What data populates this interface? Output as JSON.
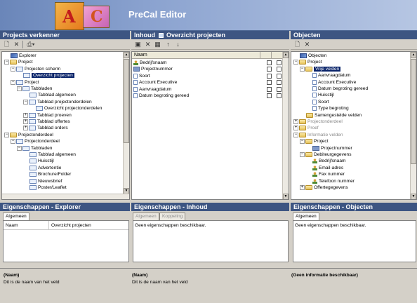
{
  "app": {
    "title": "PreCal Editor"
  },
  "panes": {
    "explorer_title": "Projects verkenner",
    "inhoud_title": "Inhoud",
    "inhoud_sub": "Overzicht projecten",
    "objecten_title": "Objecten"
  },
  "explorer_tree": [
    {
      "label": "Explorer",
      "depth": 0,
      "icon": "root",
      "exp": ""
    },
    {
      "label": "Project",
      "depth": 0,
      "icon": "folder",
      "exp": "−"
    },
    {
      "label": "Projecten scherm",
      "depth": 1,
      "icon": "page",
      "exp": "−"
    },
    {
      "label": "Overzicht projecten",
      "depth": 2,
      "icon": "page",
      "exp": "",
      "selected": true
    },
    {
      "label": "Project",
      "depth": 1,
      "icon": "page",
      "exp": "−"
    },
    {
      "label": "Tabbladen",
      "depth": 2,
      "icon": "page",
      "exp": "−"
    },
    {
      "label": "Tabblad algemeen",
      "depth": 3,
      "icon": "page",
      "exp": ""
    },
    {
      "label": "Tabblad projectonderdelen",
      "depth": 3,
      "icon": "page",
      "exp": "−"
    },
    {
      "label": "Overzicht projectonderdelen",
      "depth": 4,
      "icon": "page",
      "exp": ""
    },
    {
      "label": "Tabblad proeven",
      "depth": 3,
      "icon": "page",
      "exp": "+"
    },
    {
      "label": "Tabblad offertes",
      "depth": 3,
      "icon": "page",
      "exp": "+"
    },
    {
      "label": "Tabblad orders",
      "depth": 3,
      "icon": "page",
      "exp": "+"
    },
    {
      "label": "Projectonderdeel",
      "depth": 0,
      "icon": "folder",
      "exp": "−"
    },
    {
      "label": "Projectonderdeel",
      "depth": 1,
      "icon": "page",
      "exp": "−"
    },
    {
      "label": "Tabbladen",
      "depth": 2,
      "icon": "page",
      "exp": "−"
    },
    {
      "label": "Tabblad algemeen",
      "depth": 3,
      "icon": "page",
      "exp": ""
    },
    {
      "label": "Huisstijl",
      "depth": 3,
      "icon": "page",
      "exp": ""
    },
    {
      "label": "Advertentie",
      "depth": 3,
      "icon": "page",
      "exp": ""
    },
    {
      "label": "Brochure/Folder",
      "depth": 3,
      "icon": "page",
      "exp": ""
    },
    {
      "label": "Nieuwsbrief",
      "depth": 3,
      "icon": "page",
      "exp": ""
    },
    {
      "label": "Poster/Leaflet",
      "depth": 3,
      "icon": "page",
      "exp": ""
    }
  ],
  "inhoud": {
    "column_header": "Naam",
    "rows": [
      {
        "label": "Bedrijfsnaam",
        "icon": "person",
        "c1": false,
        "c2": false
      },
      {
        "label": "Projectnummer",
        "icon": "table",
        "c1": false,
        "c2": false
      },
      {
        "label": "Soort",
        "icon": "doc",
        "c1": false,
        "c2": false
      },
      {
        "label": "Account Executive",
        "icon": "doc",
        "c1": false,
        "c2": false
      },
      {
        "label": "Aanvraagdatum",
        "icon": "doc",
        "c1": false,
        "c2": false
      },
      {
        "label": "Datum begroting gereed",
        "icon": "doc",
        "c1": false,
        "c2": false
      }
    ]
  },
  "objecten_tree": [
    {
      "label": "Objecten",
      "depth": 0,
      "icon": "root",
      "exp": ""
    },
    {
      "label": "Project",
      "depth": 0,
      "icon": "folder",
      "exp": "−"
    },
    {
      "label": "Vrije velden",
      "depth": 1,
      "icon": "folder",
      "exp": "−",
      "selected": true
    },
    {
      "label": "Aanvraagdatum",
      "depth": 2,
      "icon": "doc",
      "exp": ""
    },
    {
      "label": "Account Executive",
      "depth": 2,
      "icon": "doc",
      "exp": ""
    },
    {
      "label": "Datum begroting gereed",
      "depth": 2,
      "icon": "doc",
      "exp": ""
    },
    {
      "label": "Huisstijl",
      "depth": 2,
      "icon": "doc",
      "exp": ""
    },
    {
      "label": "Soort",
      "depth": 2,
      "icon": "doc",
      "exp": ""
    },
    {
      "label": "Type begroting",
      "depth": 2,
      "icon": "doc",
      "exp": ""
    },
    {
      "label": "Samengestelde velden",
      "depth": 1,
      "icon": "folder",
      "exp": ""
    },
    {
      "label": "Projectonderdeel",
      "depth": 0,
      "icon": "folder",
      "exp": "+",
      "grey": true
    },
    {
      "label": "Proef",
      "depth": 0,
      "icon": "folder",
      "exp": "+",
      "grey": true
    },
    {
      "label": "Informatie velden",
      "depth": 0,
      "icon": "folder",
      "exp": "−",
      "grey": true
    },
    {
      "label": "Project",
      "depth": 1,
      "icon": "folder",
      "exp": "−"
    },
    {
      "label": "Projectnummer",
      "depth": 2,
      "icon": "table",
      "exp": ""
    },
    {
      "label": "Debiteurgegevens",
      "depth": 1,
      "icon": "folder",
      "exp": "−"
    },
    {
      "label": "Bedrijfsnaam",
      "depth": 2,
      "icon": "person",
      "exp": ""
    },
    {
      "label": "Email-adres",
      "depth": 2,
      "icon": "person",
      "exp": ""
    },
    {
      "label": "Fax nummer",
      "depth": 2,
      "icon": "person",
      "exp": ""
    },
    {
      "label": "Telefoon nummer",
      "depth": 2,
      "icon": "person",
      "exp": ""
    },
    {
      "label": "Offertegegevens",
      "depth": 1,
      "icon": "folder",
      "exp": "+"
    }
  ],
  "properties": {
    "explorer_title": "Eigenschappen - Explorer",
    "explorer_tab": "Algemeen",
    "explorer_row_key": "Naam",
    "explorer_row_value": "Overzicht projecten",
    "inhoud_title": "Eigenschappen - Inhoud",
    "inhoud_tab1": "Algemeen",
    "inhoud_tab2": "Koppeling",
    "inhoud_text": "Geen eigenschappen beschikbaar.",
    "objecten_title": "Eigenschappen - Objecten",
    "objecten_tab": "Algemeen",
    "objecten_text": "Geen eigenschappen beschikbaar."
  },
  "info": {
    "explorer_name": "(Naam)",
    "explorer_desc": "Dit is de naam van het veld",
    "inhoud_name": "(Naam)",
    "inhoud_desc": "Dit is de naam van het veld",
    "objecten_text": "(Geen informatie beschikbaar)"
  },
  "icons": {
    "new": "new-document-icon",
    "delete": "delete-icon",
    "print": "print-icon",
    "save": "save-icon",
    "properties": "properties-icon",
    "up": "arrow-up-icon",
    "down": "arrow-down-icon"
  },
  "colors": {
    "pane_header": "#3d5582",
    "selection": "#0a246a",
    "banner": "#6a86b9"
  }
}
